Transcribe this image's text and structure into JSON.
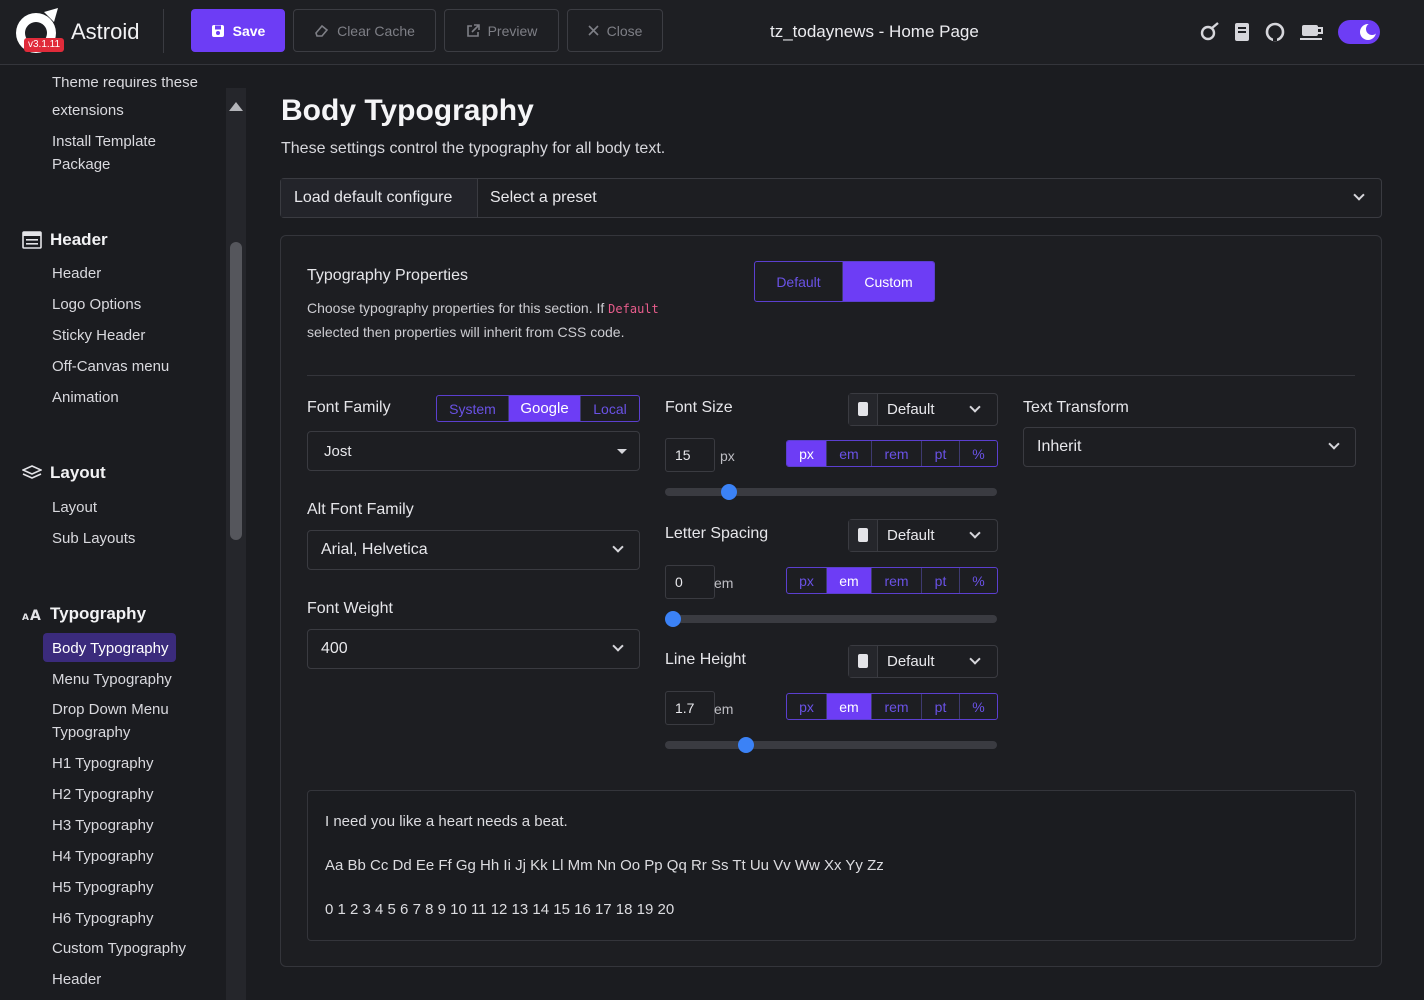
{
  "app": {
    "name": "Astroid",
    "version": "v3.1.11",
    "page_heading": "tz_todaynews - Home Page"
  },
  "toolbar": {
    "save": "Save",
    "clear_cache": "Clear Cache",
    "preview": "Preview",
    "close": "Close"
  },
  "sidebar": {
    "partial_top": "Theme requires these",
    "top_items": [
      "extensions",
      "Install Template",
      "Package"
    ],
    "header_section": "Header",
    "header_items": [
      "Header",
      "Logo Options",
      "Sticky Header",
      "Off-Canvas menu",
      "Animation"
    ],
    "layout_section": "Layout",
    "layout_items": [
      "Layout",
      "Sub Layouts"
    ],
    "typography_section": "Typography",
    "typography_items": [
      "Body Typography",
      "Menu Typography",
      "Drop Down Menu",
      "Typography",
      "H1 Typography",
      "H2 Typography",
      "H3 Typography",
      "H4 Typography",
      "H5 Typography",
      "H6 Typography",
      "Custom Typography",
      "Header"
    ]
  },
  "main": {
    "title": "Body Typography",
    "subtitle": "These settings control the typography for all body text.",
    "preset_button": "Load default configure",
    "preset_placeholder": "Select a preset"
  },
  "props": {
    "label": "Typography Properties",
    "desc_1": "Choose typography properties for this section. If",
    "desc_code": "Default",
    "desc_2": "selected then properties will inherit from CSS code.",
    "mode_default": "Default",
    "mode_custom": "Custom"
  },
  "font_family": {
    "label": "Font Family",
    "src_system": "System",
    "src_google": "Google",
    "src_local": "Local",
    "value": "Jost"
  },
  "alt_font": {
    "label": "Alt Font Family",
    "value": "Arial, Helvetica"
  },
  "font_weight": {
    "label": "Font Weight",
    "value": "400"
  },
  "units": {
    "px": "px",
    "em": "em",
    "rem": "rem",
    "pt": "pt",
    "pct": "%"
  },
  "font_size": {
    "label": "Font Size",
    "device": "Default",
    "value": "15",
    "unit": "px",
    "slider_fraction": 0.17
  },
  "letter_spacing": {
    "label": "Letter Spacing",
    "device": "Default",
    "value": "0",
    "unit": "em",
    "slider_fraction": 0.0
  },
  "line_height": {
    "label": "Line Height",
    "device": "Default",
    "value": "1.7",
    "unit": "em",
    "slider_fraction": 0.22
  },
  "text_transform": {
    "label": "Text Transform",
    "value": "Inherit"
  },
  "preview": {
    "line1": "I need you like a heart needs a beat.",
    "line2": "Aa Bb Cc Dd Ee Ff Gg Hh Ii Jj Kk Ll Mm Nn Oo Pp Qq Rr Ss Tt Uu Vv Ww Xx Yy Zz",
    "line3": "0 1 2 3 4 5 6 7 8 9 10 11 12 13 14 15 16 17 18 19 20"
  },
  "colors": {
    "accent": "#6d3df5",
    "slider": "#3b82f6",
    "version_badge": "#e02b3a"
  }
}
